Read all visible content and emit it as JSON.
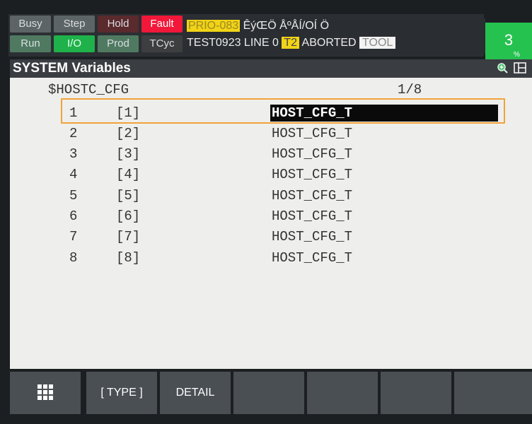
{
  "status": {
    "buttons": [
      {
        "label": "Busy"
      },
      {
        "label": "Step"
      },
      {
        "label": "Hold"
      },
      {
        "label": "Fault"
      },
      {
        "label": "Run"
      },
      {
        "label": "I/O"
      },
      {
        "label": "Prod"
      },
      {
        "label": "TCyc"
      }
    ],
    "prio": "PRIO-083",
    "garbled": " ÊýŒÖ ÅºÅÍ/OÍ  Ö",
    "program": "TEST0923 LINE 0 ",
    "mode_badge": "T2",
    "state": " ABORTED ",
    "tool_badge": "TOOL",
    "override_value": "3",
    "override_unit": "%"
  },
  "title": "SYSTEM Variables",
  "variable": {
    "name": "$HOSTC_CFG",
    "page": "1/8"
  },
  "rows": [
    {
      "index": "1",
      "bracket": "[1]",
      "type": "HOST_CFG_T"
    },
    {
      "index": "2",
      "bracket": "[2]",
      "type": "HOST_CFG_T"
    },
    {
      "index": "3",
      "bracket": "[3]",
      "type": "HOST_CFG_T"
    },
    {
      "index": "4",
      "bracket": "[4]",
      "type": "HOST_CFG_T"
    },
    {
      "index": "5",
      "bracket": "[5]",
      "type": "HOST_CFG_T"
    },
    {
      "index": "6",
      "bracket": "[6]",
      "type": "HOST_CFG_T"
    },
    {
      "index": "7",
      "bracket": "[7]",
      "type": "HOST_CFG_T"
    },
    {
      "index": "8",
      "bracket": "[8]",
      "type": "HOST_CFG_T"
    }
  ],
  "fkeys": {
    "f2": "[ TYPE ]",
    "f3": "DETAIL"
  },
  "icons": {
    "menu": "grid-menu-icon",
    "zoom": "zoom-in-icon",
    "layout": "window-layout-icon"
  },
  "colors": {
    "fault": "#f2183a",
    "io_active": "#1fb14a",
    "override": "#25c24f",
    "highlight": "#f2a23a",
    "badge_yellow": "#f2d317"
  }
}
